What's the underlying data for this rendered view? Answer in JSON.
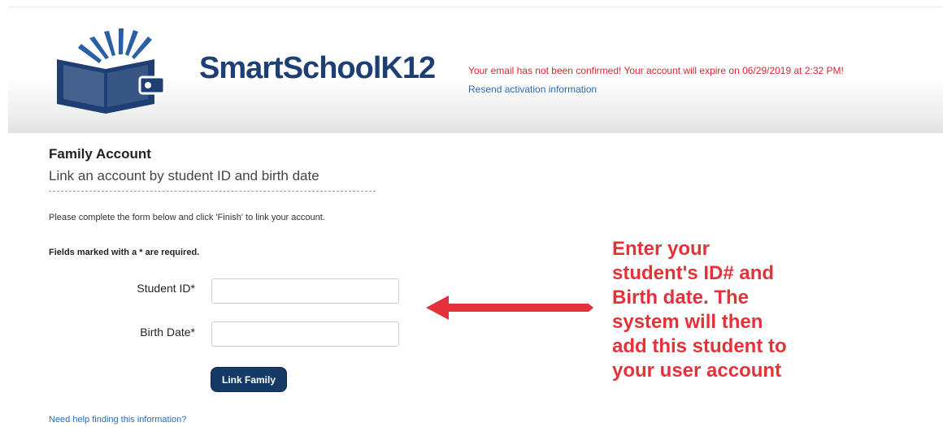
{
  "header": {
    "logo_text": "SmartSchoolK12",
    "alert_message": "Your email has not been confirmed! Your account will expire on 06/29/2019 at 2:32 PM!",
    "resend_link": "Resend activation information"
  },
  "page": {
    "title": "Family Account",
    "subtitle": "Link an account by student ID and birth date",
    "instructions": "Please complete the form below and click 'Finish' to link your account.",
    "required_note": "Fields marked with a * are required."
  },
  "form": {
    "student_id_label": "Student ID*",
    "student_id_value": "",
    "birth_date_label": "Birth Date*",
    "birth_date_value": "",
    "submit_label": "Link Family"
  },
  "help_link": "Need help finding this information?",
  "annotation": {
    "text": "Enter your\nstudent's ID# and\nBirth date.  The\nsystem will then\nadd this student to\nyour user account"
  },
  "colors": {
    "brand_navy": "#1d3f74",
    "alert_red": "#d9262c",
    "link_blue": "#2a6cb3",
    "button_navy": "#163a66",
    "annotation_red": "#e4323a"
  },
  "icons": {
    "logo": "book-logo-icon",
    "pointer": "left-arrow-icon"
  }
}
